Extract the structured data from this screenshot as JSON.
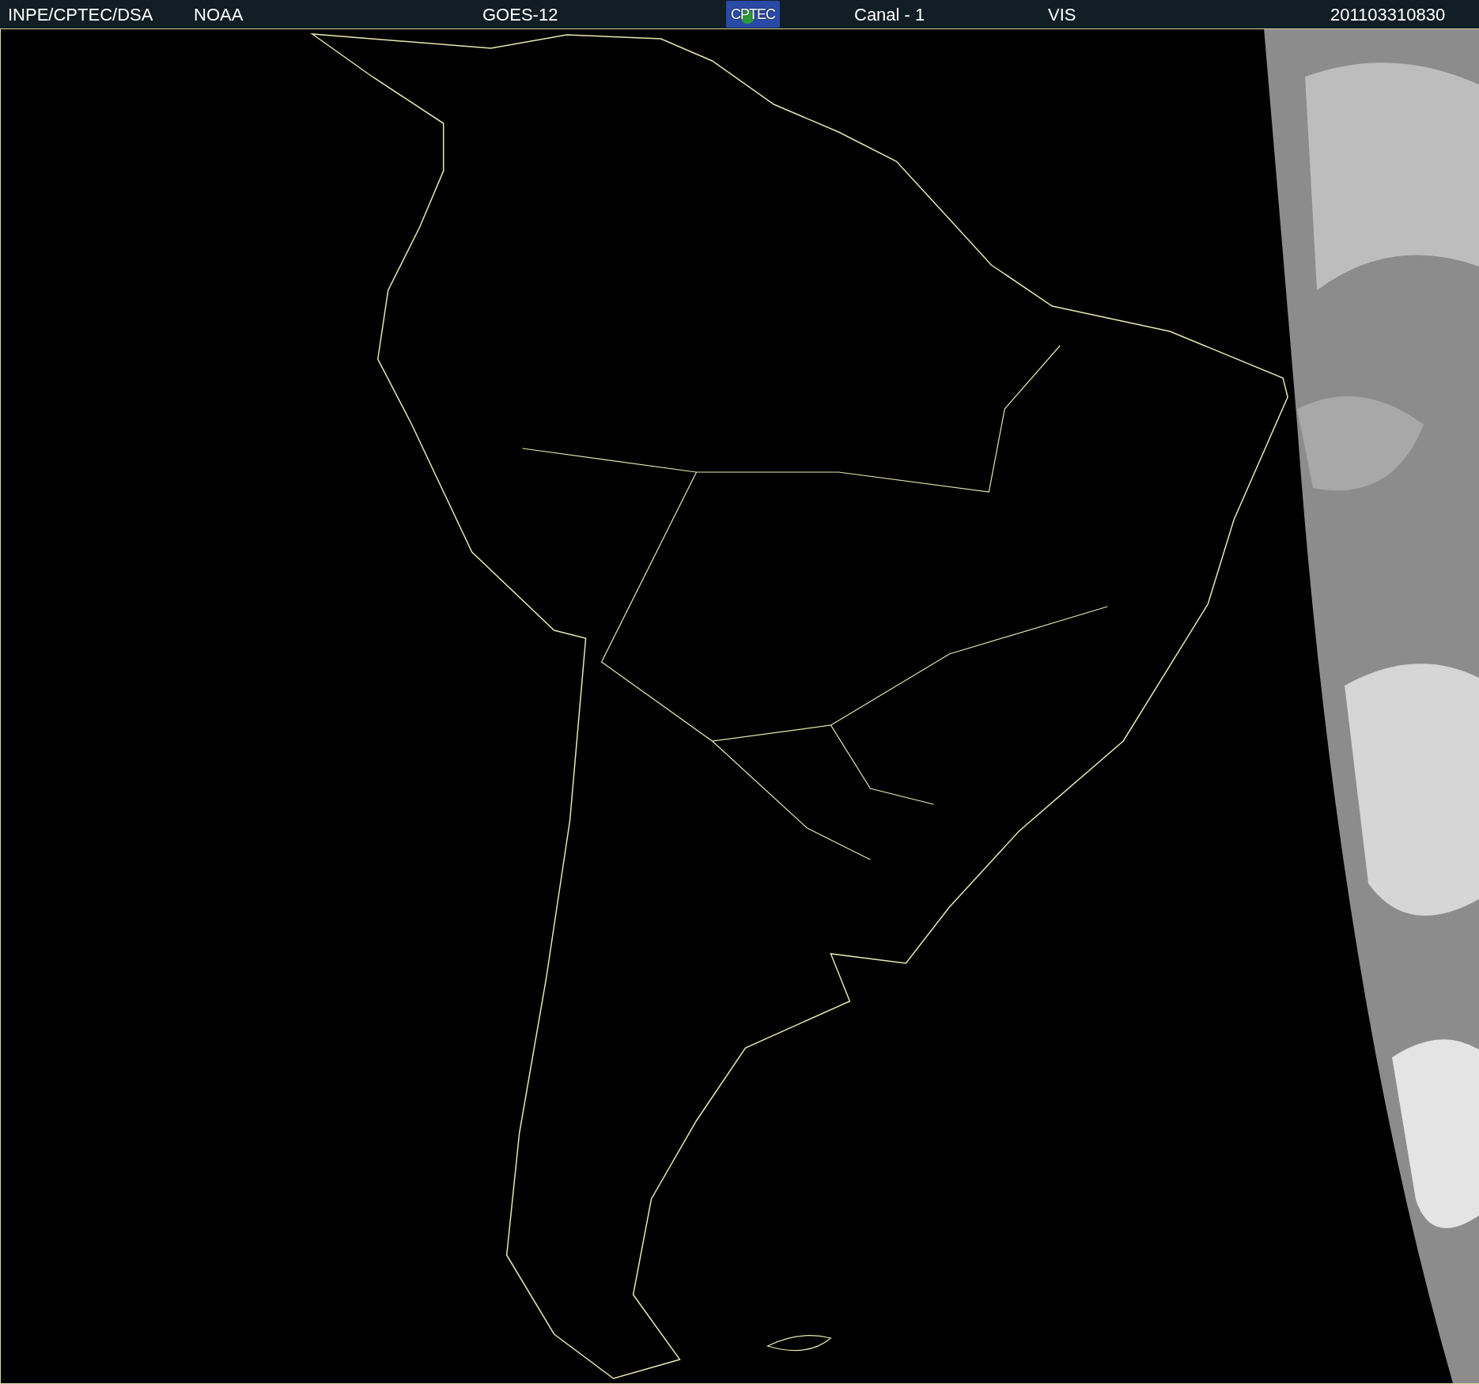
{
  "header": {
    "items": [
      {
        "text": "INPE/CPTEC/DSA",
        "kind": "text"
      },
      {
        "text": "NOAA",
        "kind": "text"
      },
      {
        "text": "GOES-12",
        "kind": "text"
      },
      {
        "text": "CPTEC",
        "kind": "logo"
      },
      {
        "text": "Canal - 1",
        "kind": "text"
      },
      {
        "text": "VIS",
        "kind": "text"
      },
      {
        "text": "201103310830",
        "kind": "text"
      }
    ]
  }
}
